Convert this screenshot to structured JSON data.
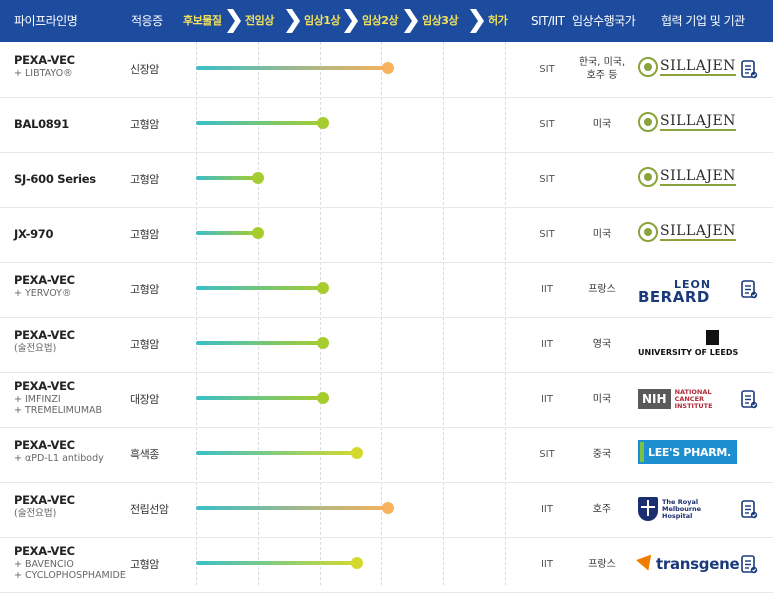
{
  "header": {
    "col_pipeline": "파이프라인명",
    "col_indication": "적응증",
    "stages": [
      "후보물질",
      "전임상",
      "임상1상",
      "임상2상",
      "임상3상",
      "허가"
    ],
    "col_type": "SIT/IIT",
    "col_country": "임상수행국가",
    "col_partner": "협력 기업 및 기관"
  },
  "colors": {
    "header_bg": "#1d4c9f",
    "stage_text": "#f2e15b",
    "bar_start": "#3bbfc8",
    "dot_green": "#a7cc2e",
    "dot_yellow": "#d4d92d",
    "dot_orange": "#f7b25a"
  },
  "rows": [
    {
      "name": "PEXA-VEC",
      "sub": [
        "+ LIBTAYO®"
      ],
      "indication": "신장암",
      "stage_progress": 0.62,
      "dot": "orange",
      "type": "SIT",
      "country": [
        "한국, 미국,",
        "호주 등"
      ],
      "partner": "SILLAJEN",
      "partner_icon": "sillajen-logo",
      "doc": true
    },
    {
      "name": "BAL0891",
      "sub": [],
      "indication": "고형암",
      "stage_progress": 0.41,
      "dot": "green",
      "type": "SIT",
      "country": [
        "미국"
      ],
      "partner": "SILLAJEN",
      "partner_icon": "sillajen-logo",
      "doc": false
    },
    {
      "name": "SJ-600 Series",
      "sub": [],
      "indication": "고형암",
      "stage_progress": 0.2,
      "dot": "green",
      "type": "SIT",
      "country": [],
      "partner": "SILLAJEN",
      "partner_icon": "sillajen-logo",
      "doc": false
    },
    {
      "name": "JX-970",
      "sub": [],
      "indication": "고형암",
      "stage_progress": 0.2,
      "dot": "green",
      "type": "SIT",
      "country": [
        "미국"
      ],
      "partner": "SILLAJEN",
      "partner_icon": "sillajen-logo",
      "doc": false
    },
    {
      "name": "PEXA-VEC",
      "sub": [
        "+ YERVOY®"
      ],
      "indication": "고형암",
      "stage_progress": 0.41,
      "dot": "green",
      "type": "IIT",
      "country": [
        "프랑스"
      ],
      "partner": "CENTRE LEON BERARD",
      "partner_icon": "leon-berard-logo",
      "doc": true
    },
    {
      "name": "PEXA-VEC",
      "sub": [
        "(술전요법)"
      ],
      "indication": "고형암",
      "stage_progress": 0.41,
      "dot": "green",
      "type": "IIT",
      "country": [
        "영국"
      ],
      "partner": "UNIVERSITY OF LEEDS",
      "partner_icon": "leeds-logo",
      "doc": false
    },
    {
      "name": "PEXA-VEC",
      "sub": [
        "+ IMFINZI",
        "+ TREMELIMUMAB"
      ],
      "indication": "대장암",
      "stage_progress": 0.41,
      "dot": "green",
      "type": "IIT",
      "country": [
        "미국"
      ],
      "partner": "NIH NATIONAL CANCER INSTITUTE",
      "partner_icon": "nih-logo",
      "doc": true
    },
    {
      "name": "PEXA-VEC",
      "sub": [
        "+ αPD-L1 antibody"
      ],
      "indication": "흑색종",
      "stage_progress": 0.52,
      "dot": "yellow",
      "type": "SIT",
      "country": [
        "중국"
      ],
      "partner": "LEE'S PHARM.",
      "partner_icon": "lees-pharm-logo",
      "doc": false
    },
    {
      "name": "PEXA-VEC",
      "sub": [
        "(술전요법)"
      ],
      "indication": "전립선암",
      "stage_progress": 0.62,
      "dot": "orange",
      "type": "IIT",
      "country": [
        "호주"
      ],
      "partner": "The Royal Melbourne Hospital",
      "partner_icon": "royal-melbourne-logo",
      "doc": true
    },
    {
      "name": "PEXA-VEC",
      "sub": [
        "+ BAVENCIO",
        "+ CYCLOPHOSPHAMIDE"
      ],
      "indication": "고형암",
      "stage_progress": 0.52,
      "dot": "yellow",
      "type": "IIT",
      "country": [
        "프랑스"
      ],
      "partner": "transgene",
      "partner_icon": "transgene-logo",
      "doc": true
    }
  ]
}
